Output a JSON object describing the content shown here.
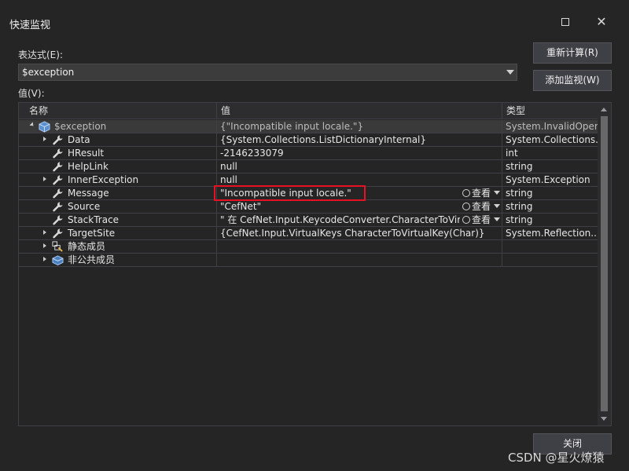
{
  "window": {
    "title": "快速监视",
    "maximize_icon": "maximize-icon",
    "close_icon": "close-icon"
  },
  "expression": {
    "label": "表达式(E):",
    "value": "$exception"
  },
  "value_label": "值(V):",
  "buttons": {
    "recalculate": "重新计算(R)",
    "add_watch": "添加监视(W)",
    "close": "关闭"
  },
  "grid": {
    "columns": [
      "名称",
      "值",
      "类型"
    ],
    "view_label": "查看",
    "rows": [
      {
        "name": "$exception",
        "value": "{\"Incompatible input locale.\"}",
        "type": "System.InvalidOper...",
        "expander": "open",
        "icon": "object-icon",
        "indent": 0,
        "selected": true,
        "view": false
      },
      {
        "name": "Data",
        "value": "{System.Collections.ListDictionaryInternal}",
        "type": "System.Collections.I...",
        "expander": "closed",
        "icon": "wrench-icon",
        "indent": 1,
        "view": false
      },
      {
        "name": "HResult",
        "value": "-2146233079",
        "type": "int",
        "expander": "none",
        "icon": "wrench-icon",
        "indent": 1,
        "view": false
      },
      {
        "name": "HelpLink",
        "value": "null",
        "type": "string",
        "expander": "none",
        "icon": "wrench-icon",
        "indent": 1,
        "view": false
      },
      {
        "name": "InnerException",
        "value": "null",
        "type": "System.Exception",
        "expander": "closed",
        "icon": "wrench-icon",
        "indent": 1,
        "view": false
      },
      {
        "name": "Message",
        "value": "\"Incompatible input locale.\"",
        "type": "string",
        "expander": "none",
        "icon": "wrench-icon",
        "indent": 1,
        "view": true
      },
      {
        "name": "Source",
        "value": "\"CefNet\"",
        "type": "string",
        "expander": "none",
        "icon": "wrench-icon",
        "indent": 1,
        "view": true
      },
      {
        "name": "StackTrace",
        "value": "\"   在 CefNet.Input.KeycodeConverter.CharacterToVirtu...",
        "type": "string",
        "expander": "none",
        "icon": "wrench-icon",
        "indent": 1,
        "view": true
      },
      {
        "name": "TargetSite",
        "value": "{CefNet.Input.VirtualKeys CharacterToVirtualKey(Char)}",
        "type": "System.Reflection....",
        "expander": "closed",
        "icon": "wrench-icon",
        "indent": 1,
        "view": false
      },
      {
        "name": "静态成员",
        "value": "",
        "type": "",
        "expander": "closed",
        "icon": "static-members-icon",
        "indent": 1,
        "view": false
      },
      {
        "name": "非公共成员",
        "value": "",
        "type": "",
        "expander": "closed",
        "icon": "nonpublic-members-icon",
        "indent": 1,
        "view": false
      }
    ]
  },
  "watermark": "CSDN @星火燎猿",
  "colors": {
    "background": "#252526",
    "input": "#3c3c3c",
    "button": "#3f3f46",
    "highlight_border": "#e81123",
    "selected_row": "#3a3a3a"
  }
}
